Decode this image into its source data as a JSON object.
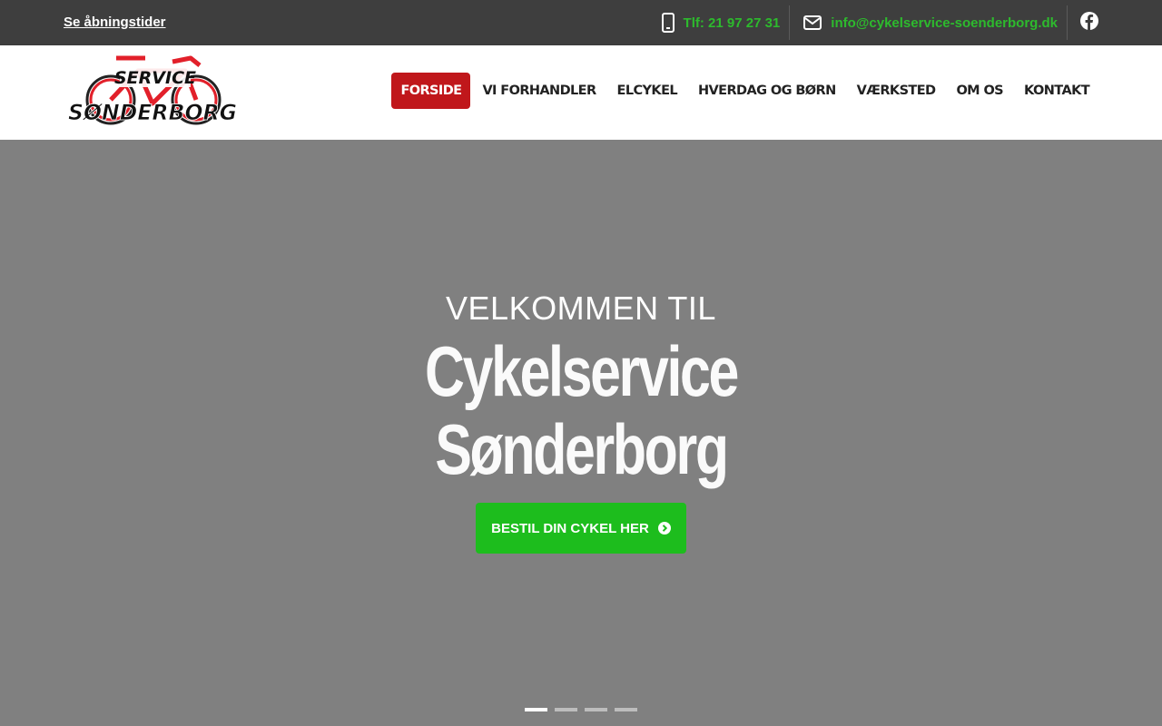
{
  "topbar": {
    "hours_link": "Se åbningstider",
    "phone": "Tlf: 21 97 27 31",
    "email": "info@cykelservice-soenderborg.dk"
  },
  "logo": {
    "top": "SERVICE",
    "bottom": "SØNDERBORG"
  },
  "nav": {
    "items": [
      "FORSIDE",
      "VI FORHANDLER",
      "ELCYKEL",
      "HVERDAG OG BØRN",
      "VÆRKSTED",
      "OM OS",
      "KONTAKT"
    ],
    "active": "FORSIDE"
  },
  "hero": {
    "pre_title": "VELKOMMEN TIL",
    "title_line1": "Cykelservice",
    "title_line2": "Sønderborg",
    "cta": "BESTIL DIN CYKEL HER"
  },
  "slider": {
    "total": 4,
    "active": 1
  },
  "colors": {
    "accent_green": "#1dbd1d",
    "accent_red": "#c0171b",
    "topbar_bg": "#3e3e3e",
    "hero_bg": "#808080"
  },
  "icons": [
    "phone-icon",
    "envelope-icon",
    "facebook-icon",
    "chevron-circle-right-icon"
  ]
}
